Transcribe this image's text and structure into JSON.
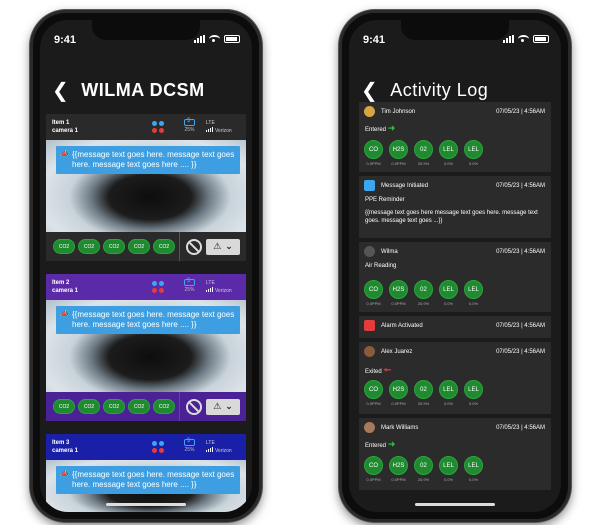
{
  "left_phone": {
    "time": "9:41",
    "title": "WILMA DCSM",
    "cards": [
      {
        "item": "Item 1",
        "camera": "camera 1",
        "battery": "25%",
        "carrier": "Verizon",
        "lte": "LTE",
        "message": "{{message text goes here. message text goes here. message text goes here .... }}",
        "sensors": [
          "CO2",
          "CO2",
          "CO2",
          "CO2",
          "CO2"
        ]
      },
      {
        "item": "Item 2",
        "camera": "camera 1",
        "battery": "25%",
        "carrier": "Verizon",
        "lte": "LTE",
        "message": "{{message text goes here. message text goes here. message text goes here .... }}",
        "sensors": [
          "CO2",
          "CO2",
          "CO2",
          "CO2",
          "CO2"
        ]
      },
      {
        "item": "Item 3",
        "camera": "camera 1",
        "battery": "25%",
        "carrier": "Verizon",
        "lte": "LTE",
        "message": "{{message text goes here. message text goes here. message text goes here .... }}"
      }
    ],
    "dot_colors": [
      "#3aa8f0",
      "#3aa8f0",
      "#e53b3b",
      "#e53b3b"
    ]
  },
  "right_phone": {
    "time": "9:41",
    "title": "Activity Log",
    "entries": [
      {
        "name": "Tim Johnson",
        "date": "07/05/23 | 4:56AM",
        "sub": "Entered",
        "readings": [
          "CO",
          "H2S",
          "02",
          "LEL",
          "LEL"
        ],
        "units": [
          "0.0PPM",
          "0.0PPM",
          "20.9%",
          "0.0%",
          "0.0%"
        ]
      },
      {
        "name": "Message Initiated",
        "date": "07/05/23 | 4:56AM",
        "sub": "PPE Reminder",
        "text": "{{message text goes here message text goes here. message text goes. message text goes ...}}"
      },
      {
        "name": "Wilma",
        "date": "07/05/23 | 4:56AM",
        "sub": "Air Reading",
        "readings": [
          "CO",
          "H2S",
          "02",
          "LEL",
          "LEL"
        ],
        "units": [
          "0.0PPM",
          "0.0PPM",
          "20.9%",
          "0.0%",
          "0.0%"
        ]
      },
      {
        "name": "Alarm Activated",
        "date": "07/05/23 | 4:56AM"
      },
      {
        "name": "Alex Juarez",
        "date": "07/05/23 | 4:56AM",
        "sub": "Exited",
        "readings": [
          "CO",
          "H2S",
          "02",
          "LEL",
          "LEL"
        ],
        "units": [
          "0.0PPM",
          "0.0PPM",
          "20.9%",
          "0.0%",
          "0.0%"
        ]
      },
      {
        "name": "Mark Williams",
        "date": "07/05/23 | 4:56AM",
        "sub": "Entered",
        "readings": [
          "CO",
          "H2S",
          "02",
          "LEL",
          "LEL"
        ],
        "units": [
          "0.0PPM",
          "0.0PPM",
          "20.9%",
          "0.0%",
          "0.0%"
        ]
      }
    ]
  }
}
